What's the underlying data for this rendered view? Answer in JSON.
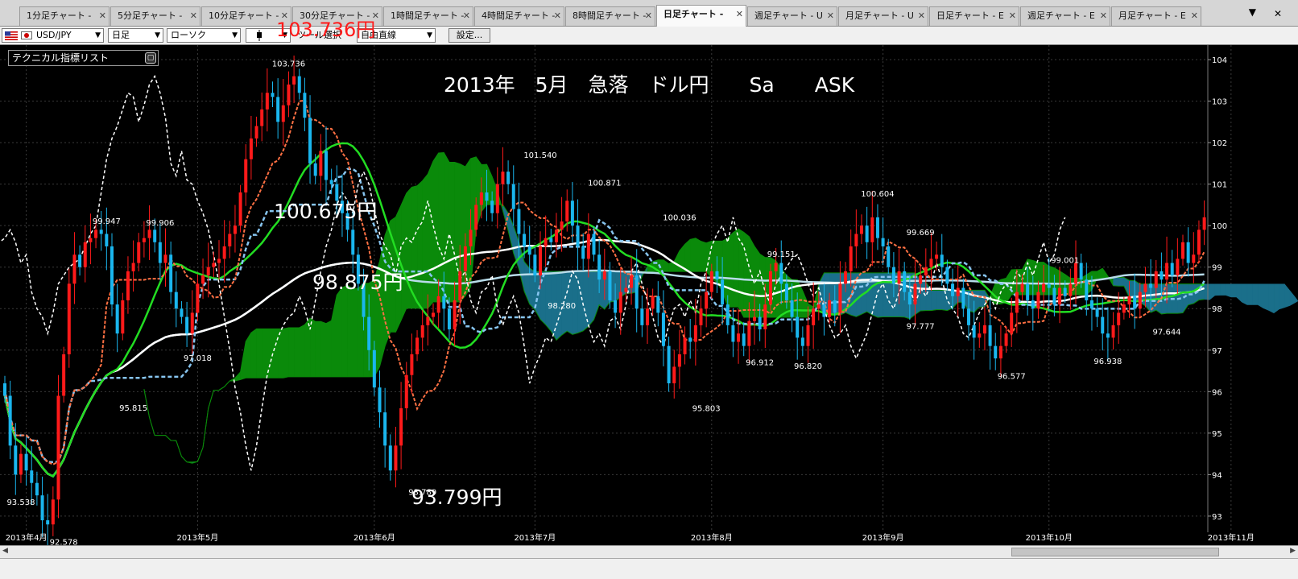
{
  "tabs": [
    {
      "label": "1分足チャート - ",
      "active": false
    },
    {
      "label": "5分足チャート - ",
      "active": false
    },
    {
      "label": "10分足チャート - ",
      "active": false
    },
    {
      "label": "30分足チャート - ",
      "active": false
    },
    {
      "label": "1時間足チャート - ",
      "active": false
    },
    {
      "label": "4時間足チャート - ",
      "active": false
    },
    {
      "label": "8時間足チャート - ",
      "active": false
    },
    {
      "label": "日足チャート - ",
      "active": true
    },
    {
      "label": "週足チャート - U",
      "active": false
    },
    {
      "label": "月足チャート - U",
      "active": false
    },
    {
      "label": "日足チャート - E",
      "active": false
    },
    {
      "label": "週足チャート - E",
      "active": false
    },
    {
      "label": "月足チャート - E",
      "active": false
    }
  ],
  "toolbar": {
    "symbol": "USD/JPY",
    "timeframe": "日足",
    "chart_style": "ローソク",
    "candle_icon": "candle-icon",
    "tool_select": "ツール選択",
    "line_tool": "自由直線",
    "settings": "設定..."
  },
  "panel": {
    "title": "テクニカル指標リスト"
  },
  "annotations": {
    "title_text": "2013年　5月　急落　ドル円　　Sa　　ASK",
    "high_red": "103.736円",
    "level1": "100.675円",
    "level2": "98.875円",
    "low": "93.799円"
  },
  "colors": {
    "bull": "#ff1a1a",
    "bear": "#1ab6ee",
    "cloud": "#0a8a0a",
    "cloud_blue": "#1a6f8a",
    "conv": "#ff7043",
    "base": "#87c5f0",
    "ma_green": "#22dd22",
    "ma_white": "#ffffff",
    "ma_lightblue": "#b8dcea",
    "chikou": "#ffffff"
  },
  "chart_data": {
    "type": "candlestick",
    "title": "2013年　5月　急落　ドル円　　Sa　　ASK",
    "xlabel": "",
    "ylabel": "",
    "ylim": [
      92.3,
      104.35
    ],
    "yticks": [
      93,
      94,
      95,
      96,
      97,
      98,
      99,
      100,
      101,
      102,
      103,
      104
    ],
    "x_ticks": [
      "2013年4月",
      "2013年5月",
      "2013年6月",
      "2013年7月",
      "2013年8月",
      "2013年9月",
      "2013年10月",
      "2013年11月"
    ],
    "x_tick_index": [
      4,
      36,
      69,
      99,
      132,
      164,
      195,
      229
    ],
    "grid": true,
    "closes": [
      95.9,
      94.7,
      94.0,
      94.5,
      94.1,
      93.8,
      93.5,
      92.9,
      92.8,
      93.4,
      95.9,
      96.9,
      98.6,
      99.3,
      99.0,
      99.6,
      99.7,
      99.9,
      99.8,
      99.5,
      98.1,
      97.4,
      98.2,
      98.9,
      99.1,
      99.6,
      99.7,
      99.9,
      99.6,
      99.1,
      99.3,
      98.4,
      98.0,
      97.8,
      97.4,
      97.9,
      98.6,
      98.8,
      99.0,
      99.1,
      99.2,
      99.5,
      99.8,
      100.0,
      100.8,
      101.6,
      102.1,
      102.4,
      102.8,
      103.2,
      103.1,
      102.5,
      102.9,
      103.4,
      103.6,
      103.2,
      102.6,
      101.5,
      101.2,
      101.8,
      101.1,
      101.0,
      100.6,
      100.3,
      99.9,
      99.3,
      98.6,
      97.8,
      97.0,
      96.1,
      95.5,
      94.7,
      94.1,
      94.7,
      95.6,
      96.4,
      96.9,
      97.3,
      97.6,
      97.8,
      97.9,
      98.3,
      98.0,
      97.5,
      98.2,
      98.9,
      99.5,
      99.9,
      100.5,
      100.8,
      100.6,
      100.3,
      101.0,
      101.3,
      101.0,
      100.4,
      99.8,
      99.5,
      99.3,
      98.8,
      99.5,
      99.7,
      99.6,
      99.9,
      100.1,
      100.6,
      100.0,
      99.5,
      99.2,
      99.8,
      99.3,
      98.7,
      98.9,
      98.2,
      97.9,
      98.4,
      98.5,
      98.8,
      98.0,
      97.6,
      98.0,
      98.3,
      97.9,
      97.1,
      96.2,
      96.6,
      96.9,
      97.3,
      97.2,
      97.6,
      98.0,
      98.4,
      98.9,
      98.7,
      98.1,
      97.6,
      97.2,
      97.4,
      97.1,
      97.7,
      97.8,
      97.5,
      98.1,
      98.9,
      99.1,
      98.6,
      98.2,
      97.8,
      97.3,
      97.1,
      97.6,
      98.0,
      98.1,
      97.8,
      98.2,
      97.9,
      98.6,
      98.9,
      99.5,
      99.8,
      100.0,
      99.6,
      100.2,
      99.7,
      99.5,
      99.0,
      98.6,
      98.9,
      98.4,
      98.1,
      98.6,
      98.8,
      99.0,
      99.2,
      99.3,
      99.0,
      98.6,
      98.3,
      98.5,
      98.0,
      97.6,
      97.3,
      97.4,
      97.6,
      97.1,
      96.8,
      97.1,
      97.4,
      97.9,
      98.4,
      98.6,
      98.2,
      98.0,
      98.4,
      98.6,
      98.5,
      98.1,
      98.5,
      98.3,
      98.6,
      99.1,
      98.7,
      98.2,
      98.0,
      97.8,
      97.4,
      97.3,
      97.6,
      97.9,
      98.1,
      98.3,
      98.0,
      98.4,
      98.6,
      98.5,
      98.9,
      98.7,
      99.1,
      98.8,
      99.2,
      99.6,
      99.1,
      99.3,
      99.9,
      100.2
    ],
    "price_labels": [
      {
        "value": 103.736,
        "index": 53,
        "pos": "above"
      },
      {
        "value": 99.947,
        "index": 19,
        "pos": "above"
      },
      {
        "value": 99.906,
        "index": 29,
        "pos": "above"
      },
      {
        "value": 97.018,
        "index": 36,
        "pos": "below"
      },
      {
        "value": 95.815,
        "index": 24,
        "pos": "below"
      },
      {
        "value": 93.538,
        "index": 3,
        "pos": "below"
      },
      {
        "value": 92.578,
        "index": 11,
        "pos": "below"
      },
      {
        "value": 93.789,
        "index": 78,
        "pos": "below"
      },
      {
        "value": 101.54,
        "index": 100,
        "pos": "above"
      },
      {
        "value": 100.871,
        "index": 112,
        "pos": "above"
      },
      {
        "value": 100.036,
        "index": 126,
        "pos": "above"
      },
      {
        "value": 98.28,
        "index": 104,
        "pos": "below"
      },
      {
        "value": 95.803,
        "index": 131,
        "pos": "below"
      },
      {
        "value": 96.912,
        "index": 141,
        "pos": "below"
      },
      {
        "value": 99.151,
        "index": 145,
        "pos": "above"
      },
      {
        "value": 96.82,
        "index": 150,
        "pos": "below"
      },
      {
        "value": 100.604,
        "index": 163,
        "pos": "above"
      },
      {
        "value": 99.669,
        "index": 171,
        "pos": "above"
      },
      {
        "value": 97.777,
        "index": 171,
        "pos": "below"
      },
      {
        "value": 96.577,
        "index": 188,
        "pos": "below"
      },
      {
        "value": 99.001,
        "index": 198,
        "pos": "above"
      },
      {
        "value": 96.938,
        "index": 206,
        "pos": "below"
      },
      {
        "value": 97.644,
        "index": 217,
        "pos": "below"
      }
    ]
  }
}
